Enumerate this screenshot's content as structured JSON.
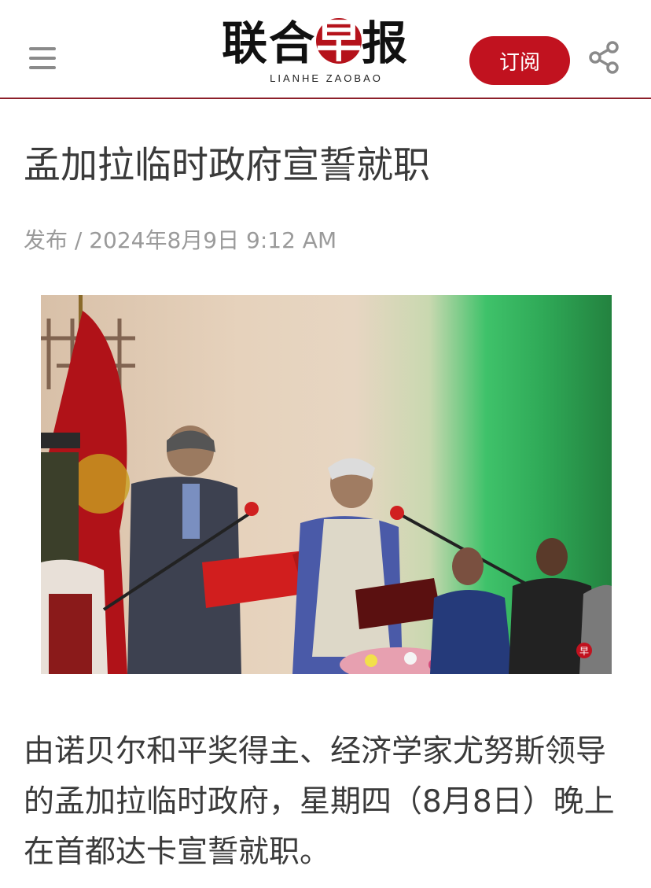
{
  "header": {
    "logo_chinese": "联合早报",
    "logo_chars": [
      "联",
      "合",
      "早",
      "报"
    ],
    "logo_english": "LIANHE ZAOBAO",
    "subscribe_label": "订阅",
    "menu_icon": "hamburger-menu-icon",
    "share_icon": "share-icon",
    "brand_color": "#c1121f",
    "divider_color": "#8c1f2a"
  },
  "article": {
    "headline": "孟加拉临时政府宣誓就职",
    "published": "发布 / 2024年8月9日 9:12 AM",
    "photo_watermark": "早",
    "body": "由诺贝尔和平奖得主、经济学家尤努斯领导的孟加拉临时政府，星期四（8月8日）晚上在首都达卡宣誓就职。"
  }
}
